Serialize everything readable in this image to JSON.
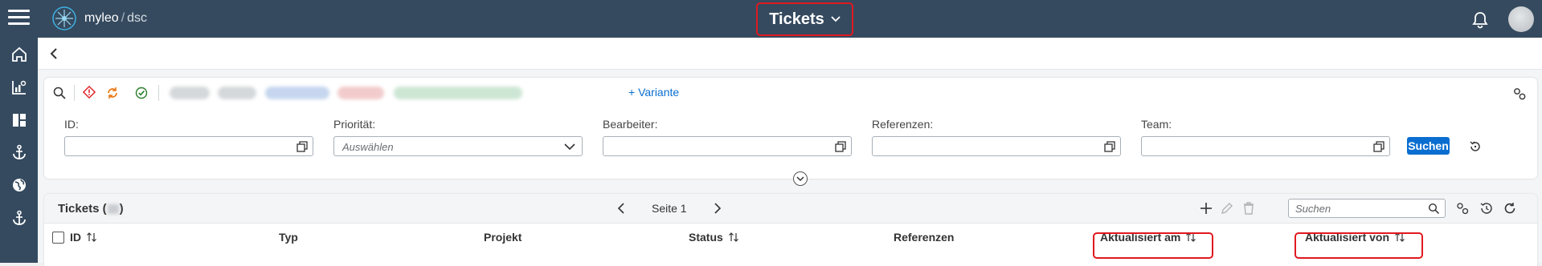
{
  "header": {
    "logo_name": "myleo",
    "logo_sep": "/",
    "logo_suffix": "dsc",
    "title": "Tickets"
  },
  "sidebar": {
    "items": [
      "home-icon",
      "analytics-icon",
      "dashboard-icon",
      "anchor-icon",
      "globe-icon",
      "anchor-icon"
    ]
  },
  "filter_toolbar": {
    "variant_label": "+ Variante"
  },
  "filters": [
    {
      "label": "ID:",
      "placeholder": ""
    },
    {
      "label": "Priorität:",
      "placeholder": "Auswählen"
    },
    {
      "label": "Bearbeiter:",
      "placeholder": ""
    },
    {
      "label": "Referenzen:",
      "placeholder": ""
    },
    {
      "label": "Team:",
      "placeholder": ""
    }
  ],
  "search_button": "Suchen",
  "table": {
    "title_prefix": "Tickets (",
    "title_suffix": ")",
    "page_label": "Seite 1",
    "search_placeholder": "Suchen",
    "columns": [
      "ID",
      "Typ",
      "Projekt",
      "Status",
      "Referenzen",
      "Aktualisiert am",
      "Aktualisiert von"
    ]
  },
  "colors": {
    "topbar": "#354a5f",
    "accent": "#0a6ed1",
    "highlight": "#e0191f"
  }
}
